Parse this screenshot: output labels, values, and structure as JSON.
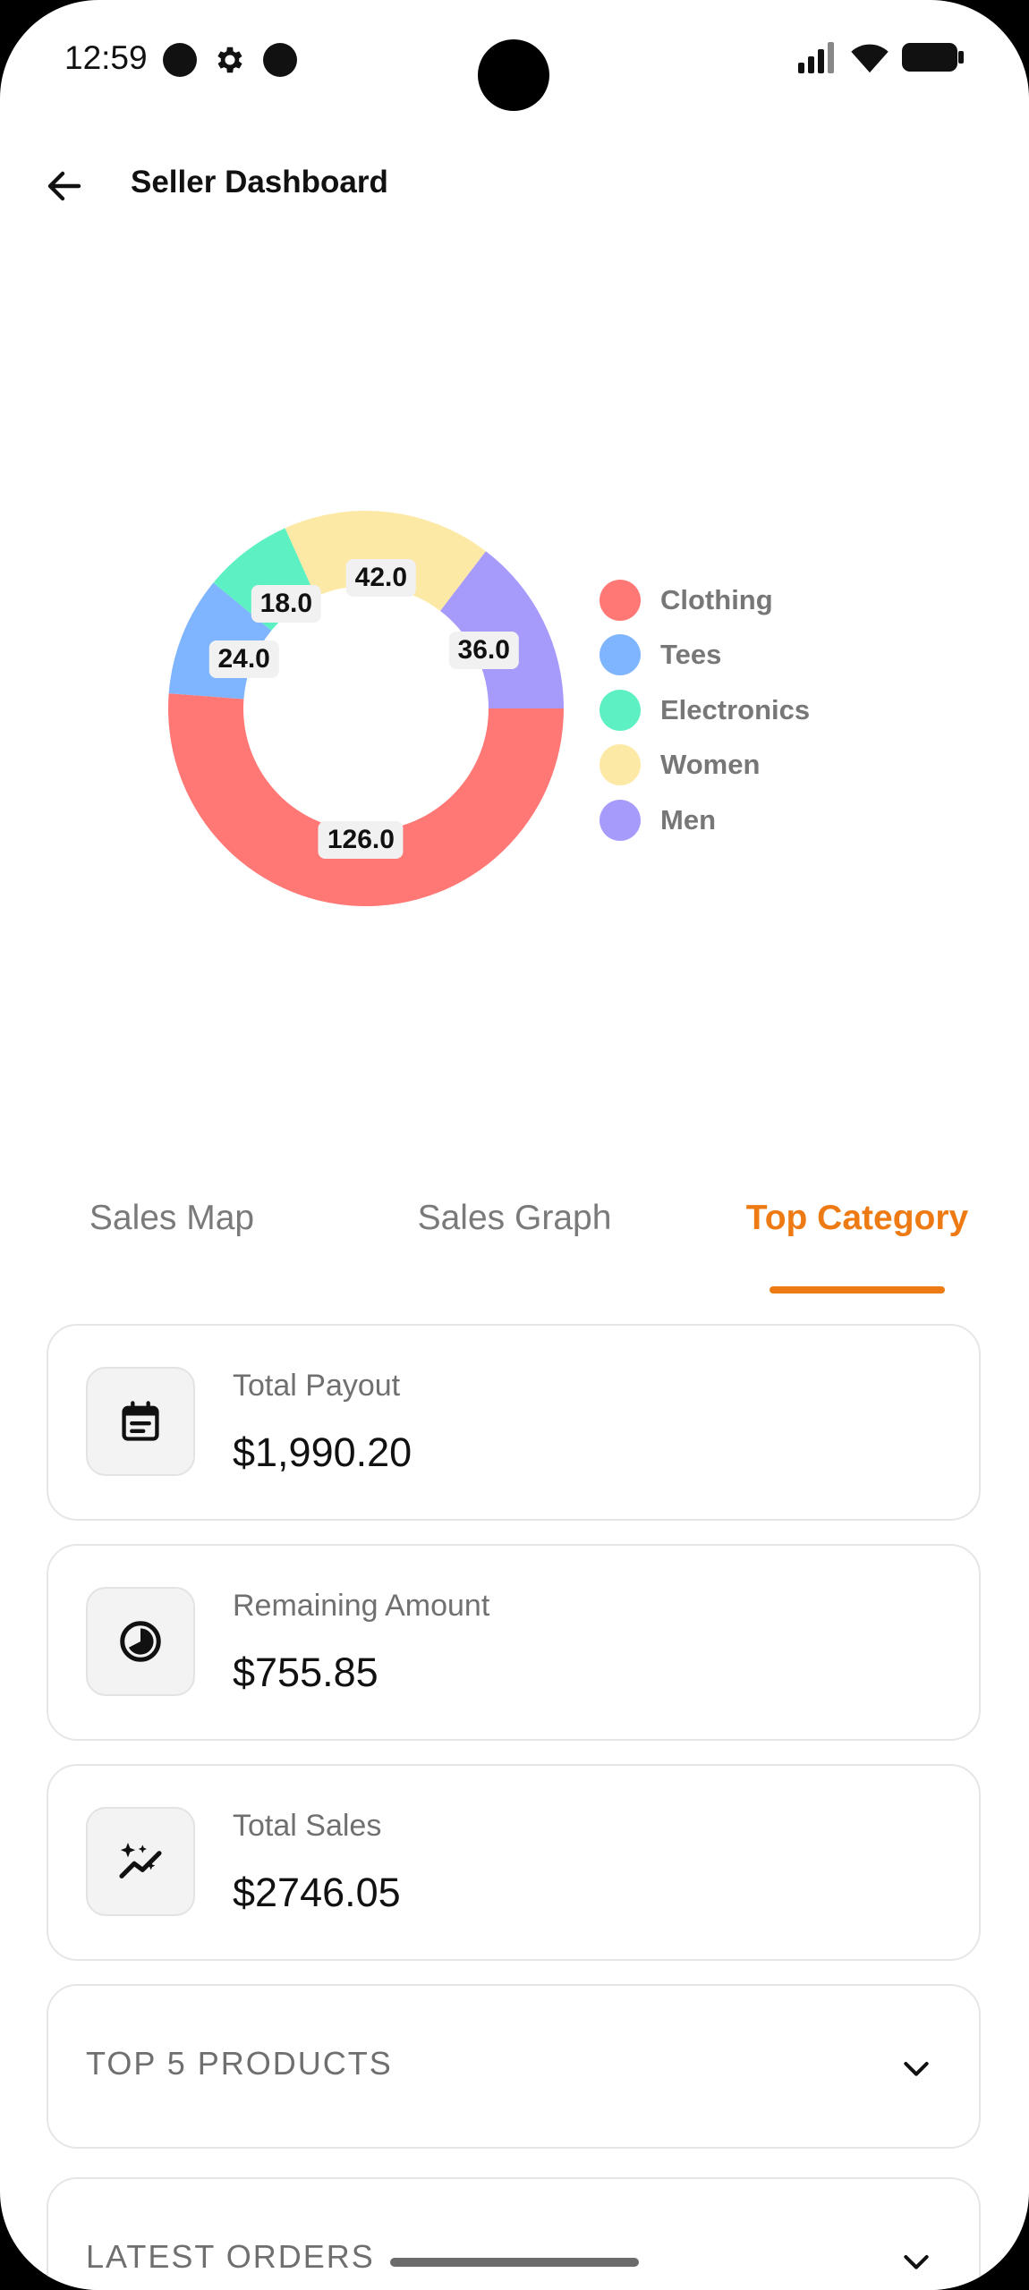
{
  "status_bar": {
    "time": "12:59"
  },
  "app_bar": {
    "title": "Seller Dashboard"
  },
  "chart_data": {
    "type": "pie",
    "variant": "donut",
    "categories": [
      "Clothing",
      "Tees",
      "Electronics",
      "Women",
      "Men"
    ],
    "values": [
      126.0,
      24.0,
      18.0,
      42.0,
      36.0
    ],
    "value_labels": [
      "126.0",
      "24.0",
      "18.0",
      "42.0",
      "36.0"
    ],
    "colors": [
      "#ff7875",
      "#7fb5fe",
      "#5df0c2",
      "#fde9a6",
      "#a69bfb"
    ],
    "legend_position": "right"
  },
  "tabs": [
    {
      "label": "Sales Map",
      "active": false
    },
    {
      "label": "Sales Graph",
      "active": false
    },
    {
      "label": "Top Category",
      "active": true
    }
  ],
  "accent_color": "#ee7a14",
  "stats": [
    {
      "label": "Total Payout",
      "value": "$1,990.20",
      "icon": "calendar-icon"
    },
    {
      "label": "Remaining Amount",
      "value": "$755.85",
      "icon": "pie-chart-icon"
    },
    {
      "label": "Total Sales",
      "value": "$2746.05",
      "icon": "sparkle-trend-icon"
    }
  ],
  "sections": [
    {
      "title": "TOP 5 PRODUCTS"
    },
    {
      "title": "LATEST ORDERS"
    }
  ]
}
